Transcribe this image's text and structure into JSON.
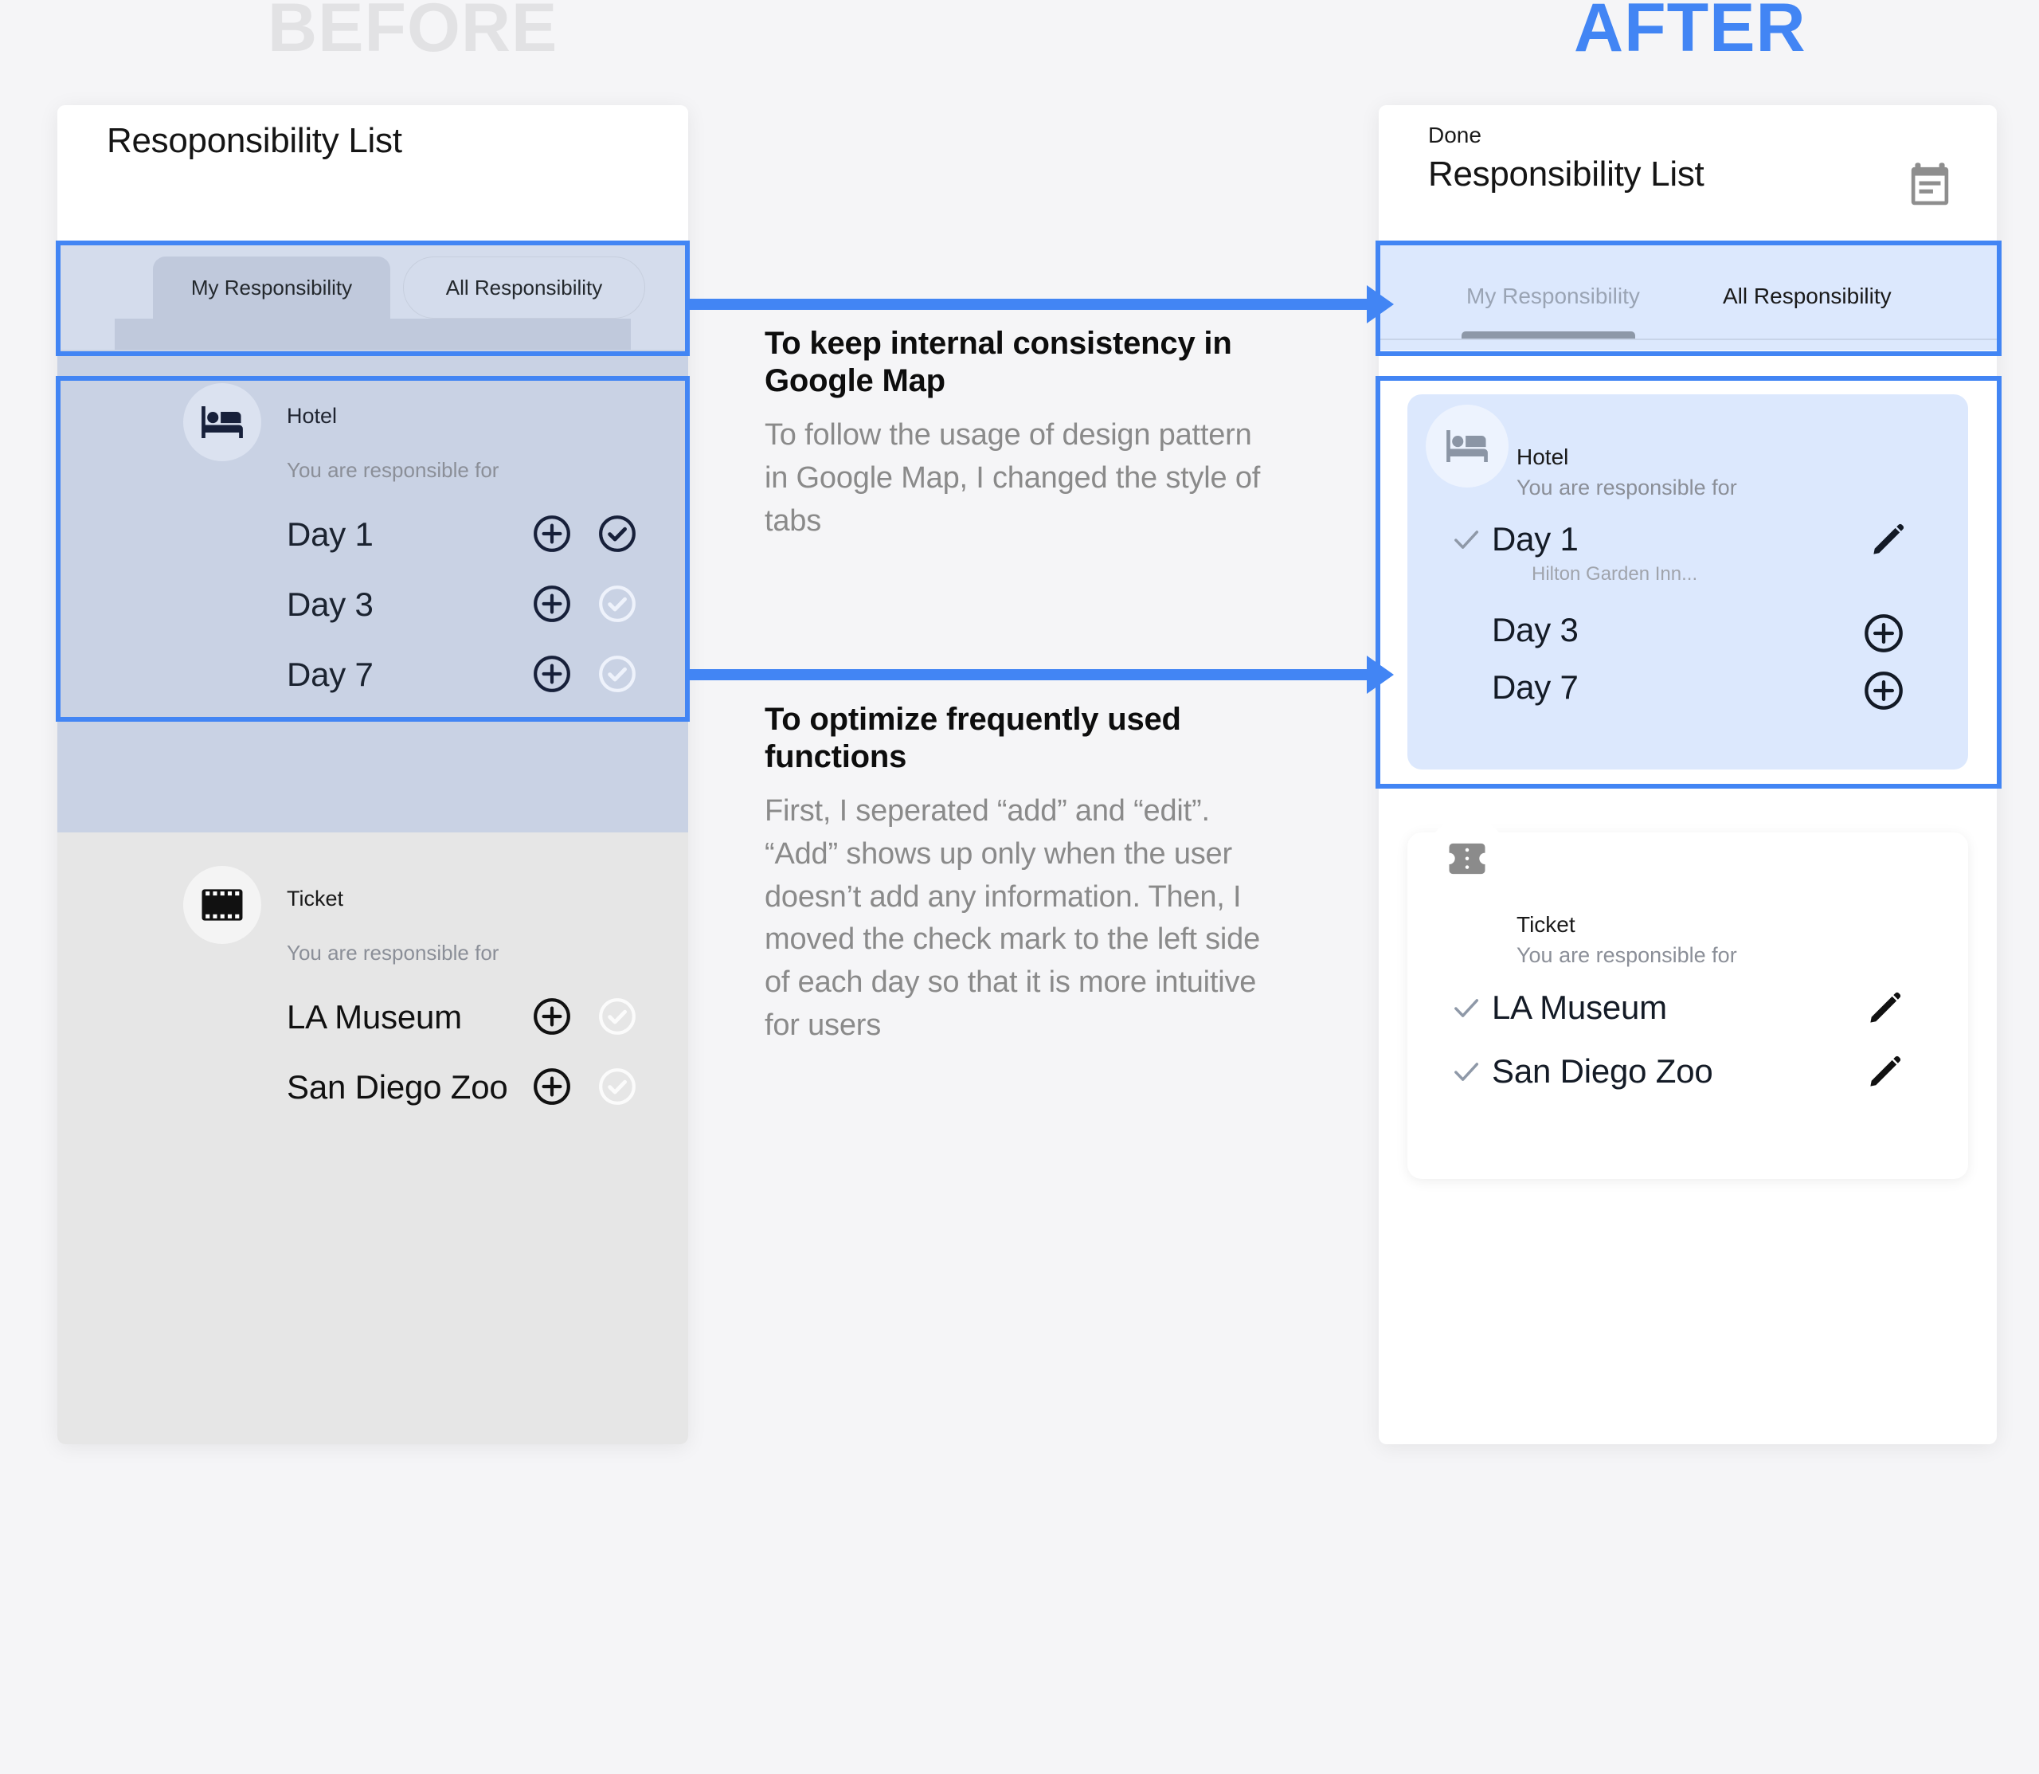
{
  "captions": {
    "before": "BEFORE",
    "after": "AFTER"
  },
  "colors": {
    "accent_blue": "#4285f4",
    "before_caption": "#e2e2e4",
    "page_bg": "#f5f5f7",
    "highlight_fill_before": "#c9d2e4",
    "highlight_fill_after": "#dce8fd"
  },
  "before": {
    "title": "Resoponsibility List",
    "tabs": [
      {
        "label": "My Responsibility",
        "selected": true
      },
      {
        "label": "All Responsibility",
        "selected": false
      }
    ],
    "groups": [
      {
        "icon": "bed-icon",
        "name": "Hotel",
        "subtitle": "You are responsible for",
        "highlighted": true,
        "rows": [
          {
            "label": "Day 1",
            "add_icon": "plus-circle-icon",
            "check_icon": "check-circle-icon",
            "checked": true
          },
          {
            "label": "Day 3",
            "add_icon": "plus-circle-icon",
            "check_icon": "check-circle-icon",
            "checked": false
          },
          {
            "label": "Day 7",
            "add_icon": "plus-circle-icon",
            "check_icon": "check-circle-icon",
            "checked": false
          }
        ]
      },
      {
        "icon": "ticket-film-icon",
        "name": "Ticket",
        "subtitle": "You are responsible for",
        "highlighted": false,
        "rows": [
          {
            "label": "LA Museum",
            "add_icon": "plus-circle-icon",
            "check_icon": "check-circle-icon",
            "checked": false
          },
          {
            "label": "San Diego Zoo",
            "add_icon": "plus-circle-icon",
            "check_icon": "check-circle-icon",
            "checked": false
          }
        ]
      }
    ]
  },
  "after": {
    "done_label": "Done",
    "title": "Responsibility List",
    "header_icon": "calendar-icon",
    "tabs": [
      {
        "label": "My Responsibility",
        "selected": true
      },
      {
        "label": "All Responsibility",
        "selected": false
      }
    ],
    "cards": [
      {
        "icon": "bed-icon",
        "name": "Hotel",
        "subtitle": "You are responsible for",
        "highlighted": true,
        "rows": [
          {
            "label": "Day 1",
            "checked": true,
            "detail": "Hilton Garden Inn...",
            "action_icon": "pencil-icon"
          },
          {
            "label": "Day 3",
            "checked": false,
            "detail": "",
            "action_icon": "plus-circle-icon"
          },
          {
            "label": "Day 7",
            "checked": false,
            "detail": "",
            "action_icon": "plus-circle-icon"
          }
        ]
      },
      {
        "icon": "ticket-icon",
        "name": "Ticket",
        "subtitle": "You are responsible for",
        "highlighted": false,
        "rows": [
          {
            "label": "LA Museum",
            "checked": true,
            "detail": "",
            "action_icon": "pencil-icon"
          },
          {
            "label": "San Diego Zoo",
            "checked": true,
            "detail": "",
            "action_icon": "pencil-icon"
          }
        ]
      }
    ]
  },
  "annotations": [
    {
      "title": "To keep internal consistency in Google Map",
      "body": "To follow the usage of design pattern in Google Map, I changed the style of tabs"
    },
    {
      "title": "To optimize frequently used functions",
      "body": "First, I seperated “add” and “edit”. “Add” shows up only when the user doesn’t add any information. Then, I moved the check mark to the left side of each day so that it is more intuitive for users"
    }
  ]
}
